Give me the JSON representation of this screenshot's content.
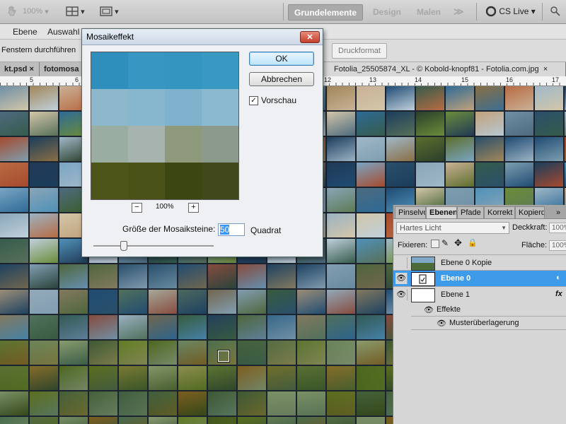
{
  "appbar": {
    "zoom": "100%",
    "workspaces": [
      "Grundelemente",
      "Design",
      "Malen"
    ],
    "more": "≫",
    "cslive": "CS Live"
  },
  "menu": {
    "items": [
      "Ebene",
      "Auswahl"
    ]
  },
  "options": {
    "label": "Fenstern durchführen",
    "druckformat": "Druckformat"
  },
  "tabs": [
    {
      "label": "kt.psd",
      "close": "×"
    },
    {
      "label": "fotomosa"
    },
    {
      "label": "Fotolia_25505874_XL - © Kobold-knopf81 - Fotolia.com.jpg",
      "close": "×"
    }
  ],
  "ruler": {
    "numbers": [
      "5",
      "6",
      "12",
      "13",
      "14",
      "15",
      "16",
      "17"
    ]
  },
  "dialog": {
    "title": "Mosaikeffekt",
    "close": "✕",
    "ok": "OK",
    "cancel": "Abbrechen",
    "preview_label": "Vorschau",
    "preview_checked": "✓",
    "zoom_minus": "−",
    "zoom_plus": "+",
    "zoom": "100%",
    "size_label": "Größe der Mosaiksteine:",
    "size_value": "50",
    "unit": "Quadrat",
    "preview_colors": [
      "#2e8fbd",
      "#3796c2",
      "#3495c0",
      "#3a99c3",
      "#8db8cc",
      "#86b7ce",
      "#7fb3cd",
      "#8bb9cf",
      "#99ada1",
      "#a6b3ae",
      "#8f9a7d",
      "#8c9a8e",
      "#4d5518",
      "#4b5217",
      "#3c4613",
      "#41481b"
    ]
  },
  "panel": {
    "tabs": [
      "Pinselvo",
      "Ebenen",
      "Pfade",
      "Korrekt",
      "Kopierq"
    ],
    "more": "»",
    "blend_mode": "Hartes Licht",
    "opacity_label": "Deckkraft:",
    "opacity": "100%",
    "lock_label": "Fixieren:",
    "fill_label": "Fläche:",
    "fill": "100%",
    "layers": [
      {
        "name": "Ebene 0 Kopie",
        "visible": false,
        "selected": false
      },
      {
        "name": "Ebene 0",
        "visible": true,
        "selected": true
      },
      {
        "name": "Ebene 1",
        "visible": true,
        "selected": false,
        "fx": "fx"
      }
    ],
    "effects_label": "Effekte",
    "effect_item": "Musterüberlagerung"
  },
  "colors": {
    "accent": "#3d9be9",
    "mosaic": [
      "#6f8fa6",
      "#3b6f92",
      "#b7c7d3",
      "#a1875a",
      "#2a4f6a",
      "#89a5b7",
      "#c9b196",
      "#4d6a7e",
      "#9cb3c3",
      "#1f4b73",
      "#5e7b56",
      "#d2c6a9",
      "#365c4c",
      "#7d9eaf",
      "#a64a2e",
      "#2e6a96",
      "#c0d0dc",
      "#58705a",
      "#8a6e44",
      "#1b3d5c",
      "#4f91b8",
      "#b86b43",
      "#6b8c3a",
      "#2b3f2b",
      "#a0b8c8",
      "#3d5f2f",
      "#c2a27b",
      "#213a56",
      "#7aa5c4",
      "#5c6e2c"
    ]
  }
}
